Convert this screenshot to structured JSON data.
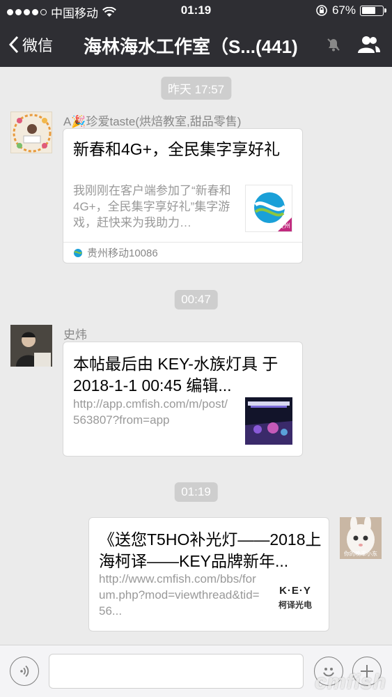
{
  "status_bar": {
    "carrier": "中国移动",
    "time": "01:19",
    "battery": "67%",
    "battery_level": 0.67
  },
  "nav": {
    "back_label": "微信",
    "title": "海林海水工作室（S...(441)"
  },
  "messages": [
    {
      "time_label": "昨天 17:57",
      "sender": "A🎉珍爱taste(烘焙教室,甜品零售)",
      "card_title": "新春和4G+，全民集字享好礼",
      "card_desc": "我刚刚在客户端参加了“新春和4G+，全民集字享好礼”集字游戏，赶快来为我助力…",
      "thumb_badge": "贵州",
      "footer": "贵州移动10086"
    },
    {
      "time_label": "00:47",
      "sender": "史炜",
      "card_title": "本帖最后由 KEY-水族灯具 于 2018-1-1 00:45 编辑...",
      "card_desc": "http://app.cmfish.com/m/post/563807?from=app"
    },
    {
      "time_label": "01:19",
      "card_title": "《送您T5HO补光灯——2018上海柯译——KEY品牌新年...",
      "card_desc": "http://www.cmfish.com/bbs/forum.php?mod=viewthread&tid=56...",
      "thumb_logo": "K·E·Y",
      "thumb_logo_sub": "柯译光电",
      "avatar_caption": "你的晚辈小东"
    }
  ],
  "input": {
    "value": ""
  },
  "watermark": "cmfish",
  "colors": {
    "nav_bg": "#2e2e33",
    "chat_bg": "#ebebeb",
    "pill_bg": "#cecece"
  }
}
